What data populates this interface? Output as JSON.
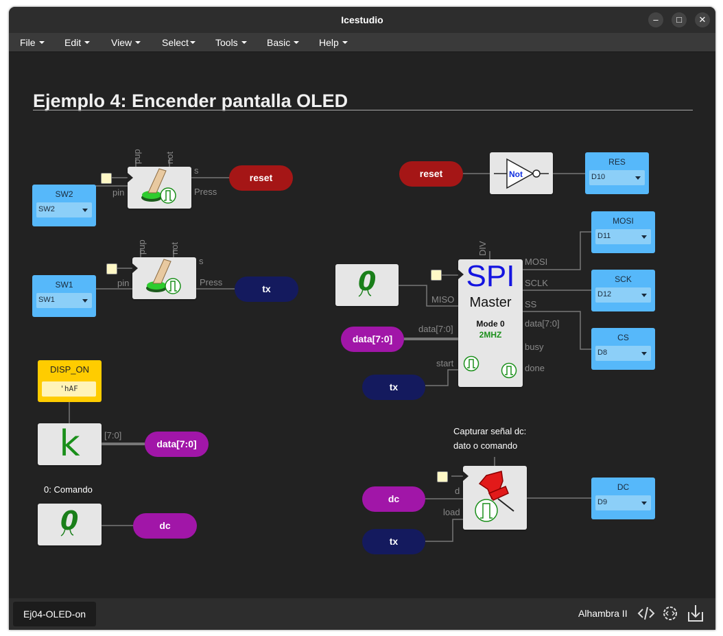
{
  "window": {
    "title": "Icestudio",
    "controls": {
      "minimize": "–",
      "maximize": "□",
      "close": "✕"
    }
  },
  "menubar": {
    "items": [
      "File",
      "Edit",
      "View",
      "Select",
      "Tools",
      "Basic",
      "Help"
    ]
  },
  "design": {
    "heading": "Ejemplo 4: Encender pantalla OLED"
  },
  "blocks": {
    "sw2_input": {
      "name": "SW2",
      "value": "SW2"
    },
    "sw1_input": {
      "name": "SW1",
      "value": "SW1"
    },
    "button_ports": {
      "pup": "pup",
      "not": "not",
      "pin": "pin",
      "s": "s",
      "press": "Press"
    },
    "const_disp_on": {
      "name": "DISP_ON",
      "value": "'hAF"
    },
    "k_bus_label": "[7:0]",
    "note_comando": "0: Comando",
    "not_gate": {
      "label": "Not"
    },
    "res_output": {
      "name": "RES",
      "value": "D10"
    },
    "mosi_output": {
      "name": "MOSI",
      "value": "D11"
    },
    "sck_output": {
      "name": "SCK",
      "value": "D12"
    },
    "cs_output": {
      "name": "CS",
      "value": "D8"
    },
    "dc_output": {
      "name": "DC",
      "value": "D9"
    },
    "spi": {
      "title": "SPI",
      "subtitle": "Master",
      "mode": "Mode 0",
      "freq": "2MHZ",
      "ports": {
        "div": "DIV",
        "miso": "MISO",
        "data": "data[7:0]",
        "start": "start",
        "mosi": "MOSI",
        "sclk": "SCLK",
        "ss": "SS",
        "data_out": "data[7:0]",
        "busy": "busy",
        "done": "done"
      }
    },
    "capture_note": {
      "line1": "Capturar señal dc:",
      "line2": "dato o comando"
    },
    "reg_ports": {
      "d": "d",
      "load": "load"
    },
    "labels": {
      "reset": "reset",
      "tx": "tx",
      "data": "data[7:0]",
      "dc": "dc"
    }
  },
  "statusbar": {
    "file_tab": "Ej04-OLED-on",
    "board": "Alhambra II",
    "icons": [
      "code-icon",
      "settings-icon",
      "download-icon"
    ]
  },
  "colors": {
    "input_pin": "#56b8fa",
    "label_red": "#a51616",
    "label_navy": "#141a5e",
    "label_purple": "#a116a8",
    "constant": "#ffcc00"
  }
}
